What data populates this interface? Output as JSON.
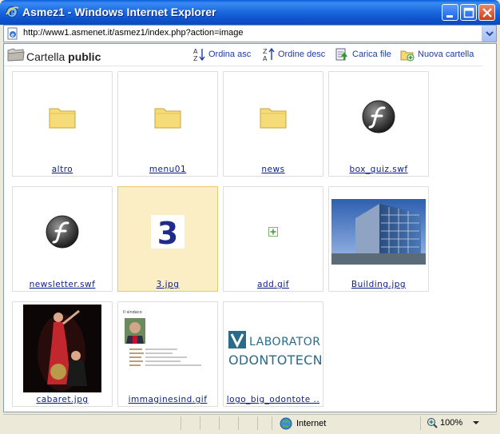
{
  "window": {
    "title": "Asmez1 - Windows Internet Explorer"
  },
  "address": {
    "url": "http://www1.asmenet.it/asmez1/index.php?action=image"
  },
  "toolbar": {
    "folder_prefix": "Cartella",
    "folder_name": "public",
    "sort_asc_label": "Ordina asc",
    "sort_desc_label": "Ordine desc",
    "upload_label": "Carica file",
    "new_folder_label": "Nuova cartella"
  },
  "items": [
    {
      "name": "altro",
      "kind": "folder"
    },
    {
      "name": "menu01",
      "kind": "folder"
    },
    {
      "name": "news",
      "kind": "folder"
    },
    {
      "name": "box_quiz.swf",
      "kind": "flash"
    },
    {
      "name": "newsletter.swf",
      "kind": "flash"
    },
    {
      "name": "3.jpg",
      "kind": "image",
      "selected": true
    },
    {
      "name": "add.gif",
      "kind": "image"
    },
    {
      "name": "Building.jpg",
      "kind": "image"
    },
    {
      "name": "cabaret.jpg",
      "kind": "image"
    },
    {
      "name": "immaginesind.gif",
      "kind": "image"
    },
    {
      "name": "logo_big_odontote ..",
      "kind": "image"
    }
  ],
  "thumb_text": {
    "three": "3",
    "sindaco_heading": "Il sindaco",
    "lab_line1": "LABORATORIO",
    "lab_line2": "ODONTOTECNICO"
  },
  "status": {
    "zone": "Internet",
    "zoom": "100%"
  },
  "colors": {
    "titlebar": "#0b52c9",
    "link": "#0b1d8a",
    "selected_bg": "#fbeec4",
    "folder": "#f6dc78"
  }
}
